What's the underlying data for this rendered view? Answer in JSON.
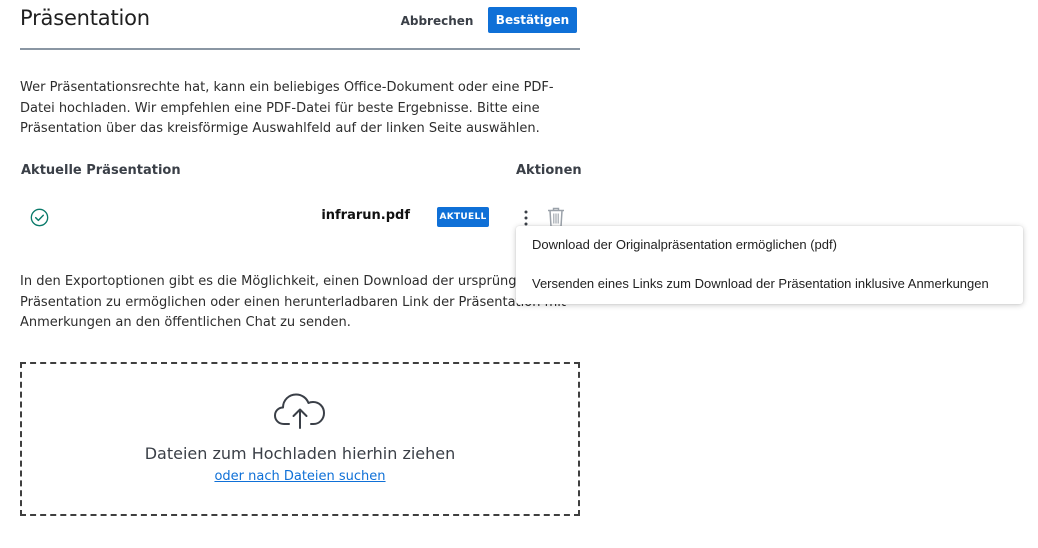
{
  "header": {
    "title": "Präsentation",
    "cancel_label": "Abbrechen",
    "confirm_label": "Bestätigen"
  },
  "intro_text": "Wer Präsentationsrechte hat, kann ein beliebiges Office-Dokument oder eine PDF-Datei hochladen. Wir empfehlen eine PDF-Datei für beste Ergebnisse. Bitte eine Präsentation über das kreisförmige Auswahlfeld auf der linken Seite auswählen.",
  "table": {
    "col_current": "Aktuelle Präsentation",
    "col_actions": "Aktionen",
    "row": {
      "file_name": "infrarun.pdf",
      "badge": "AKTUELL"
    }
  },
  "export_text": "In den Exportoptionen gibt es die Möglichkeit, einen Download der ursprünglichen Präsentation zu ermöglichen oder einen herunterladbaren Link der Präsentation mit Anmerkungen an den öffentlichen Chat zu senden.",
  "dropzone": {
    "main_text": "Dateien zum Hochladen hierhin ziehen",
    "link_text": "oder nach Dateien suchen"
  },
  "menu": {
    "items": [
      {
        "label": "Download der Originalpräsentation ermöglichen (pdf)"
      },
      {
        "label": "Versenden eines Links zum Download der Präsentation inklusive Anmerkungen"
      }
    ]
  },
  "colors": {
    "accent": "#0f70d7",
    "success": "#0a7a6a"
  },
  "icons": {
    "status": "check-circle-icon",
    "more": "more-vertical-icon",
    "delete": "trash-icon",
    "upload": "cloud-upload-icon"
  }
}
